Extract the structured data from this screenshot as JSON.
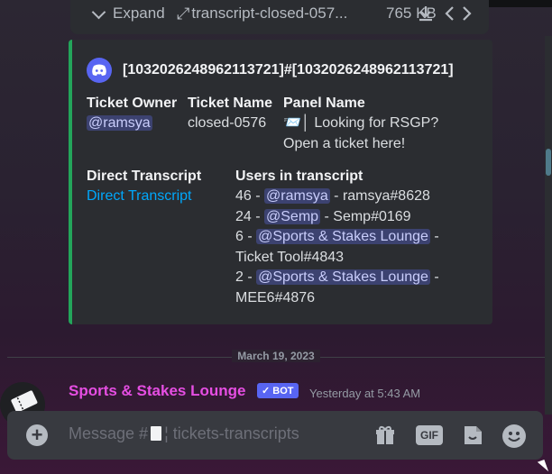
{
  "attachment": {
    "expand_label": "Expand",
    "filename": "transcript-closed-057...",
    "filesize": "765 KB"
  },
  "embed": {
    "author": "[1032026248962113721]#[1032026248962113721]",
    "accent_color": "#23a55a",
    "fields": {
      "ticket_owner": {
        "name": "Ticket Owner",
        "mention": "@ramsya"
      },
      "ticket_name": {
        "name": "Ticket Name",
        "value": "closed-0576"
      },
      "panel_name": {
        "name": "Panel Name",
        "emoji": "📨",
        "line1": "Looking for RSGP?",
        "line2": "Open a ticket here!"
      },
      "direct_transcript": {
        "name": "Direct Transcript",
        "link": "Direct Transcript"
      },
      "users": {
        "name": "Users in transcript",
        "rows": [
          {
            "count": "46 - ",
            "mention": "@ramsya",
            "tag": " - ramsya#8628"
          },
          {
            "count": "24 - ",
            "mention": "@Semp",
            "tag": " - Semp#0169"
          },
          {
            "count": "6 - ",
            "mention": "@Sports & Stakes Lounge",
            "tag": " -",
            "tag2": "Ticket Tool#4843"
          },
          {
            "count": "2 - ",
            "mention": "@Sports & Stakes Lounge",
            "tag": " -",
            "tag2": "MEE6#4876"
          }
        ]
      }
    }
  },
  "divider": {
    "date": "March 19, 2023"
  },
  "message": {
    "author": "Sports & Stakes Lounge",
    "author_color": "#e64ee3",
    "bot_tag": "✓ BOT",
    "timestamp": "Yesterday at 5:43 AM"
  },
  "composer": {
    "placeholder_prefix": "Message #",
    "placeholder_channel": "¦ tickets-transcripts",
    "gif_label": "GIF",
    "icons": [
      "plus-icon",
      "gift-icon",
      "gif-icon",
      "sticker-icon",
      "emoji-icon"
    ]
  }
}
